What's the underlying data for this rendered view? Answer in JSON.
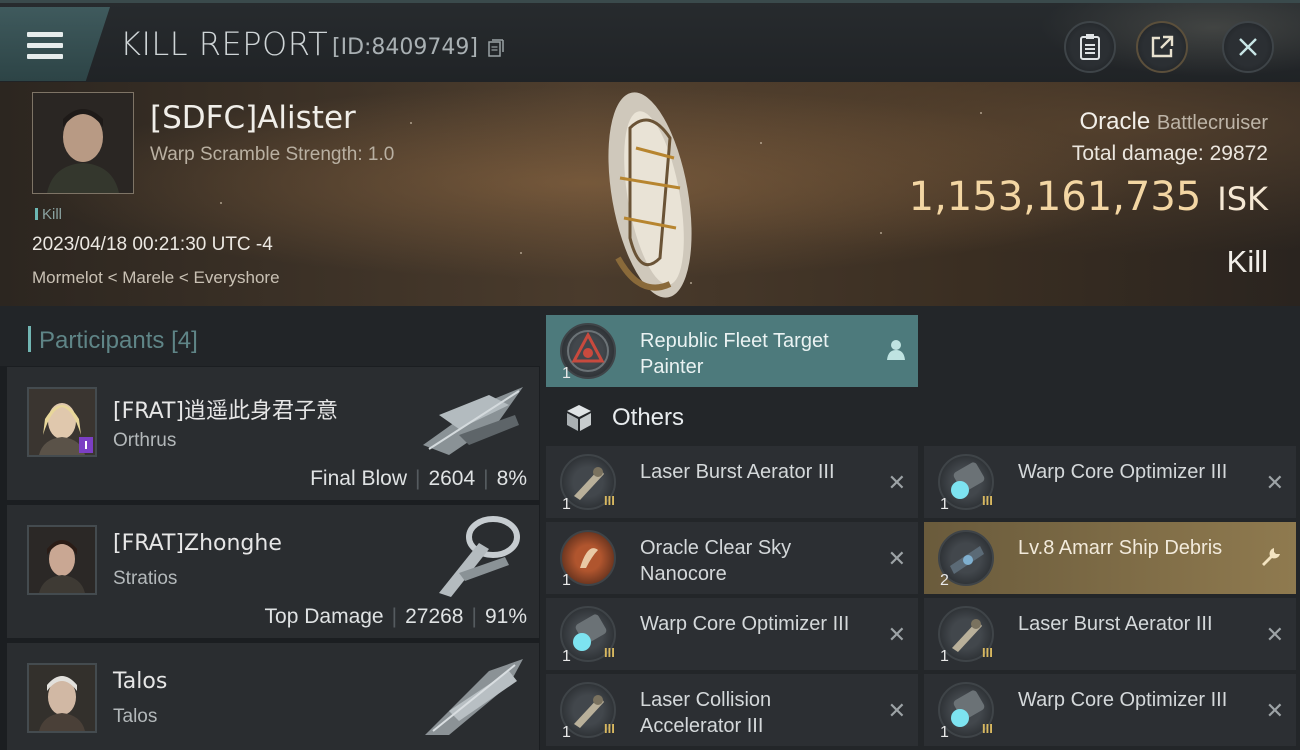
{
  "header": {
    "title": "KILL REPORT",
    "id": "[ID:8409749]",
    "buttons": [
      "clipboard-icon",
      "share-icon",
      "close-icon"
    ]
  },
  "victim": {
    "name": "[SDFC]Alister",
    "warp_scramble": "Warp Scramble Strength: 1.0",
    "tag": "Kill",
    "datetime": "2023/04/18 00:21:30 UTC -4",
    "location": "Mormelot < Marele < Everyshore",
    "ship": "Oracle",
    "ship_class": "Battlecruiser",
    "total_damage_label": "Total damage:",
    "total_damage": "29872",
    "isk_value": "1,153,161,735",
    "isk_unit": "ISK",
    "result": "Kill"
  },
  "participants": {
    "title": "Participants",
    "count": "[4]",
    "list": [
      {
        "name": "[FRAT]逍遥此身君子意",
        "ship": "Orthrus",
        "role": "Final Blow",
        "damage": "2604",
        "percent": "8%"
      },
      {
        "name": "[FRAT]Zhonghe",
        "ship": "Stratios",
        "role": "Top Damage",
        "damage": "27268",
        "percent": "91%"
      },
      {
        "name": "Talos",
        "ship": "Talos",
        "role": "",
        "damage": "",
        "percent": ""
      }
    ]
  },
  "items": {
    "highlight": {
      "name": "Republic Fleet Target Painter",
      "qty": "1"
    },
    "others_title": "Others",
    "others": [
      {
        "name": "Laser Burst Aerator III",
        "qty": "1",
        "tier": "III"
      },
      {
        "name": "Warp Core Optimizer III",
        "qty": "1",
        "tier": "III"
      },
      {
        "name": "Oracle Clear Sky Nanocore",
        "qty": "1",
        "tier": ""
      },
      {
        "name": "Lv.8 Amarr Ship Debris",
        "qty": "2",
        "tier": ""
      },
      {
        "name": "Warp Core Optimizer III",
        "qty": "1",
        "tier": "III"
      },
      {
        "name": "Laser Burst Aerator III",
        "qty": "1",
        "tier": "III"
      },
      {
        "name": "Laser Collision Accelerator III",
        "qty": "1",
        "tier": "III"
      },
      {
        "name": "Warp Core Optimizer III",
        "qty": "1",
        "tier": "III"
      }
    ]
  },
  "colors": {
    "accent_teal": "#4d7a7c",
    "isk_gold": "#f3d6a3",
    "debris_gold": "#8f7a4f"
  }
}
